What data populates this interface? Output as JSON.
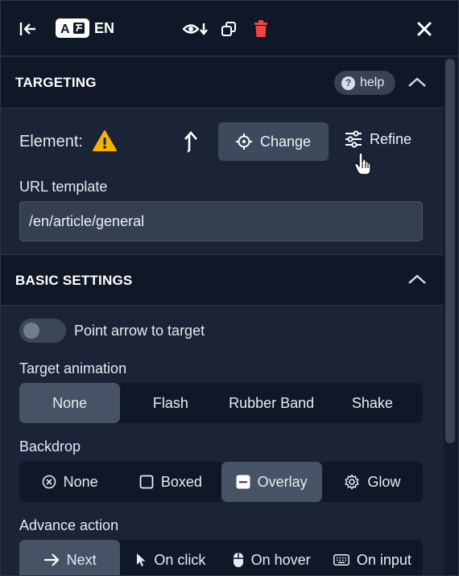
{
  "toolbar": {
    "lang_code": "EN",
    "icons": [
      "collapse-left-icon",
      "translate-icon",
      "preview-icon",
      "duplicate-icon",
      "delete-icon",
      "close-icon"
    ]
  },
  "targeting": {
    "title": "TARGETING",
    "help_label": "help",
    "element_label": "Element:",
    "change_label": "Change",
    "refine_label": "Refine",
    "url_template_label": "URL template",
    "url_template_value": "/en/article/general"
  },
  "basic_settings": {
    "title": "BASIC SETTINGS",
    "point_arrow_label": "Point arrow to target",
    "point_arrow_enabled": false,
    "target_animation": {
      "label": "Target animation",
      "options": [
        "None",
        "Flash",
        "Rubber Band",
        "Shake"
      ],
      "selected": "None"
    },
    "backdrop": {
      "label": "Backdrop",
      "options": [
        "None",
        "Boxed",
        "Overlay",
        "Glow"
      ],
      "selected": "Overlay"
    },
    "advance_action": {
      "label": "Advance action",
      "options": [
        "Next",
        "On click",
        "On hover",
        "On input"
      ],
      "selected": "Next"
    }
  },
  "colors": {
    "accent_delete": "#ef4444",
    "warning": "#f5b301",
    "header_bg": "#101827",
    "panel_bg": "#1b2436"
  }
}
